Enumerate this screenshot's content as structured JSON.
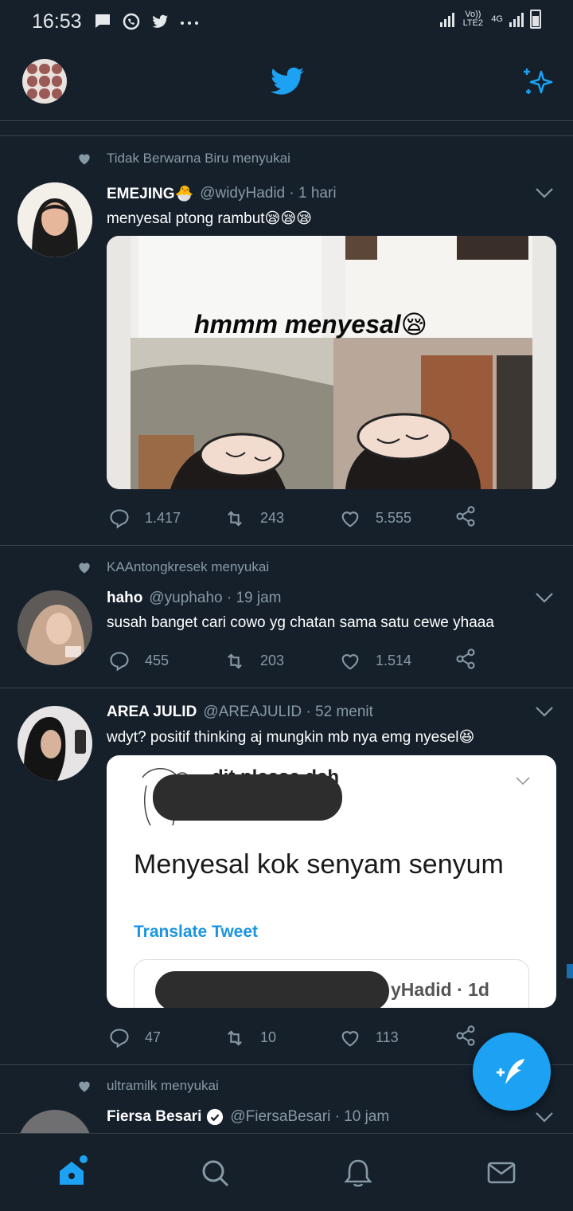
{
  "status": {
    "time": "16:53",
    "network": "Vo)) LTE2",
    "network_type": "4G"
  },
  "colors": {
    "accent": "#1da1f2",
    "background": "#15202b",
    "muted": "#8899a6",
    "divider": "#38444d"
  },
  "tweets": [
    {
      "liked_by": "Tidak Berwarna Biru menyukai",
      "name": "EMEJING🐣",
      "handle": "@widyHadid · 1 hari",
      "text": "menyesal ptong rambut😪😪😪",
      "media_caption": "hmmm menyesal😪",
      "replies": "1.417",
      "retweets": "243",
      "likes": "5.555"
    },
    {
      "liked_by": "KAAntongkresek menyukai",
      "name": "haho",
      "handle": "@yuphaho · 19 jam",
      "text": "susah banget cari cowo yg chatan sama satu cewe yhaaa",
      "replies": "455",
      "retweets": "203",
      "likes": "1.514"
    },
    {
      "name": "AREA JULID",
      "handle": "@AREAJULID · 52 menit",
      "text": "wdyt? positif thinking aj mungkin mb nya emg nyesel😆",
      "embedded": {
        "header_text": "dit please deh",
        "tweet_text": "Menyesal kok senyam senyum",
        "translate": "Translate Tweet",
        "quoted_handle": "yHadid · 1d"
      },
      "replies": "47",
      "retweets": "10",
      "likes": "113"
    },
    {
      "liked_by": "ultramilk menyukai",
      "name": "Fiersa Besari",
      "handle": "@FiersaBesari · 10 jam"
    }
  ]
}
